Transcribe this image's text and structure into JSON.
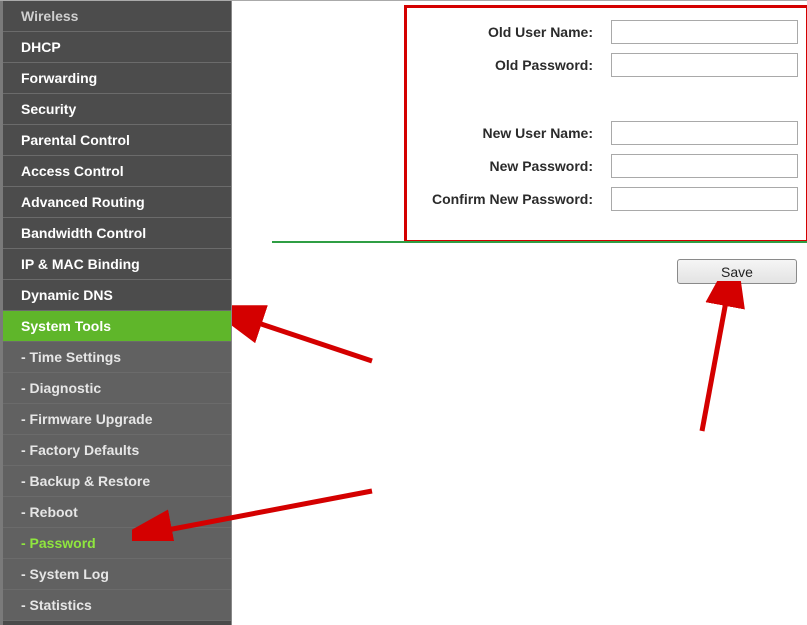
{
  "sidebar": {
    "items": [
      {
        "label": "Wireless",
        "type": "main",
        "dimmed": true
      },
      {
        "label": "DHCP",
        "type": "main"
      },
      {
        "label": "Forwarding",
        "type": "main"
      },
      {
        "label": "Security",
        "type": "main"
      },
      {
        "label": "Parental Control",
        "type": "main"
      },
      {
        "label": "Access Control",
        "type": "main"
      },
      {
        "label": "Advanced Routing",
        "type": "main"
      },
      {
        "label": "Bandwidth Control",
        "type": "main"
      },
      {
        "label": "IP & MAC Binding",
        "type": "main"
      },
      {
        "label": "Dynamic DNS",
        "type": "main"
      },
      {
        "label": "System Tools",
        "type": "main",
        "activeParent": true
      },
      {
        "label": "- Time Settings",
        "type": "sub"
      },
      {
        "label": "- Diagnostic",
        "type": "sub"
      },
      {
        "label": "- Firmware Upgrade",
        "type": "sub"
      },
      {
        "label": "- Factory Defaults",
        "type": "sub"
      },
      {
        "label": "- Backup & Restore",
        "type": "sub"
      },
      {
        "label": "- Reboot",
        "type": "sub"
      },
      {
        "label": "- Password",
        "type": "sub",
        "activeSub": true
      },
      {
        "label": "- System Log",
        "type": "sub"
      },
      {
        "label": "- Statistics",
        "type": "sub"
      }
    ]
  },
  "form": {
    "old_user_label": "Old User Name:",
    "old_password_label": "Old Password:",
    "new_user_label": "New User Name:",
    "new_password_label": "New Password:",
    "confirm_password_label": "Confirm New Password:",
    "old_user_value": "",
    "old_password_value": "",
    "new_user_value": "",
    "new_password_value": "",
    "confirm_password_value": ""
  },
  "buttons": {
    "save_label": "Save"
  },
  "colors": {
    "highlight_green": "#5fb62a",
    "rule_green": "#2f9e44",
    "arrow_red": "#d40000"
  }
}
